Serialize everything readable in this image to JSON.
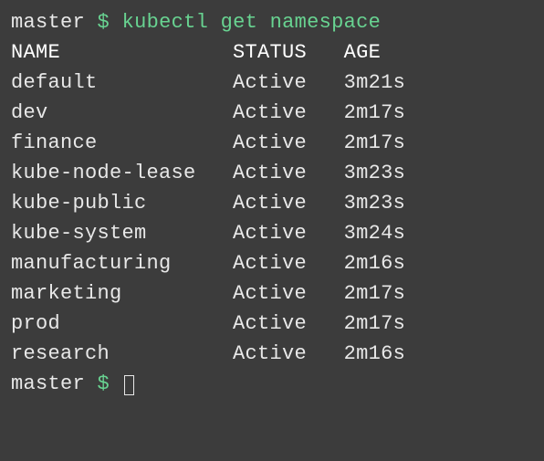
{
  "prompt": {
    "host": "master",
    "symbol": "$"
  },
  "command": "kubectl get namespace",
  "table": {
    "headers": {
      "name": "NAME",
      "status": "STATUS",
      "age": "AGE"
    },
    "rows": [
      {
        "name": "default",
        "status": "Active",
        "age": "3m21s"
      },
      {
        "name": "dev",
        "status": "Active",
        "age": "2m17s"
      },
      {
        "name": "finance",
        "status": "Active",
        "age": "2m17s"
      },
      {
        "name": "kube-node-lease",
        "status": "Active",
        "age": "3m23s"
      },
      {
        "name": "kube-public",
        "status": "Active",
        "age": "3m23s"
      },
      {
        "name": "kube-system",
        "status": "Active",
        "age": "3m24s"
      },
      {
        "name": "manufacturing",
        "status": "Active",
        "age": "2m16s"
      },
      {
        "name": "marketing",
        "status": "Active",
        "age": "2m17s"
      },
      {
        "name": "prod",
        "status": "Active",
        "age": "2m17s"
      },
      {
        "name": "research",
        "status": "Active",
        "age": "2m16s"
      }
    ]
  },
  "col_widths": {
    "name": 18,
    "status": 9
  }
}
